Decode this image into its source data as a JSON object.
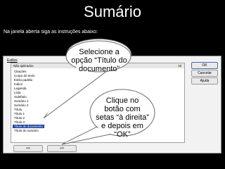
{
  "slide": {
    "title": "Sumário",
    "subtitle": "Na janela aberta  siga as instruções abaixo:"
  },
  "dialog": {
    "label": "Estilos",
    "header_left": "Não aplicados",
    "header_right": "Ní",
    "items": [
      "Citações",
      "Corpo do texto",
      "Estilo padrão",
      "Índice",
      "Legenda",
      "Lista",
      "Subtítulo",
      "Sumário 1",
      "Sumário 2",
      "Título",
      "Título 1",
      "Título 2",
      "Título 3",
      "Título do documento",
      "Título do sumário"
    ],
    "selected_index": 13,
    "buttons": {
      "ok": "OK",
      "cancel": "Cancelar",
      "help": "Ajuda"
    },
    "left_arrow": "<<",
    "right_arrow": ">>"
  },
  "callouts": {
    "top": "Selecione a opção “Título do documento”",
    "bottom": "Clique no botão com setas “à direita” e depois em “OK”"
  }
}
